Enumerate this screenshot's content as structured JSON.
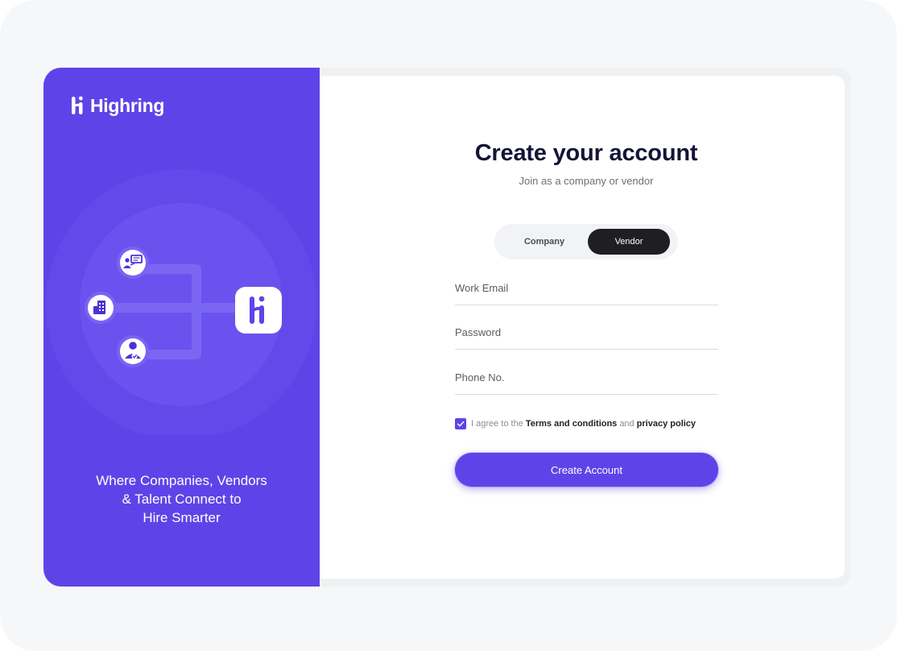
{
  "brand": {
    "name": "Highring",
    "accent": "#5e44e8"
  },
  "left": {
    "tagline_lines": [
      "Where Companies, Vendors",
      "& Talent Connect to",
      "Hire Smarter"
    ],
    "illustration_icons": [
      "presentation-icon",
      "building-icon",
      "person-check-icon",
      "highring-logo-icon"
    ]
  },
  "form": {
    "title": "Create your account",
    "subtitle": "Join as a company or vendor",
    "toggle": {
      "options": [
        "Company",
        "Vendor"
      ],
      "selected": "Vendor"
    },
    "fields": {
      "email_placeholder": "Work Email",
      "password_placeholder": "Password",
      "phone_placeholder": "Phone No."
    },
    "agree": {
      "checked": true,
      "prefix": "I agree to the",
      "terms": "Terms and conditions",
      "and": "and",
      "privacy": "privacy policy"
    },
    "submit_label": "Create Account"
  }
}
